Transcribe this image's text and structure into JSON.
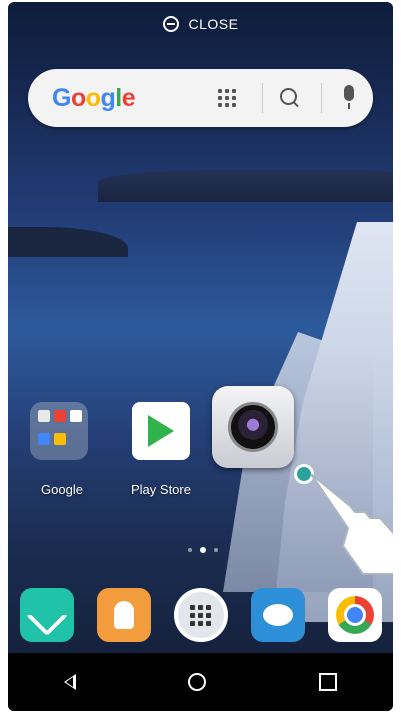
{
  "top_bar": {
    "close_label": "CLOSE"
  },
  "search": {
    "logo_text": "Google"
  },
  "home_apps": [
    {
      "label": "Google"
    },
    {
      "label": "Play Store"
    },
    {
      "label": ""
    }
  ],
  "page_indicator": {
    "pages": 3,
    "active": 2
  },
  "dock": [
    {
      "icon": "phone-icon"
    },
    {
      "icon": "contacts-icon"
    },
    {
      "icon": "app-drawer-icon"
    },
    {
      "icon": "messages-icon"
    },
    {
      "icon": "chrome-icon"
    }
  ],
  "colors": {
    "google_blue": "#4285f4",
    "google_red": "#ea4335",
    "google_yellow": "#fbbc05",
    "google_green": "#34a853",
    "touch_indicator": "#2ba39a"
  }
}
